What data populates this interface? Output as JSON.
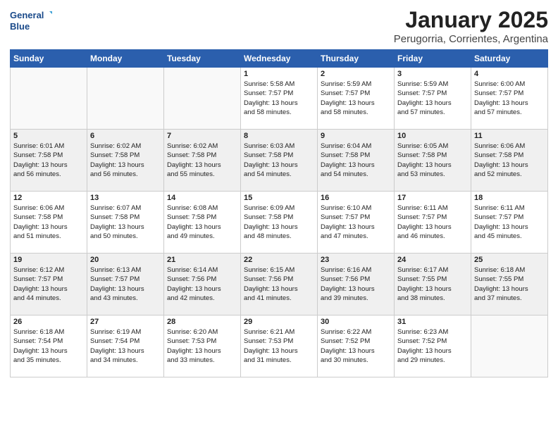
{
  "header": {
    "logo_line1": "General",
    "logo_line2": "Blue",
    "title": "January 2025",
    "subtitle": "Perugorria, Corrientes, Argentina"
  },
  "days_of_week": [
    "Sunday",
    "Monday",
    "Tuesday",
    "Wednesday",
    "Thursday",
    "Friday",
    "Saturday"
  ],
  "weeks": [
    [
      {
        "day": "",
        "text": "",
        "shaded": false,
        "empty": true
      },
      {
        "day": "",
        "text": "",
        "shaded": false,
        "empty": true
      },
      {
        "day": "",
        "text": "",
        "shaded": false,
        "empty": true
      },
      {
        "day": "1",
        "text": "Sunrise: 5:58 AM\nSunset: 7:57 PM\nDaylight: 13 hours\nand 58 minutes.",
        "shaded": false,
        "empty": false
      },
      {
        "day": "2",
        "text": "Sunrise: 5:59 AM\nSunset: 7:57 PM\nDaylight: 13 hours\nand 58 minutes.",
        "shaded": false,
        "empty": false
      },
      {
        "day": "3",
        "text": "Sunrise: 5:59 AM\nSunset: 7:57 PM\nDaylight: 13 hours\nand 57 minutes.",
        "shaded": false,
        "empty": false
      },
      {
        "day": "4",
        "text": "Sunrise: 6:00 AM\nSunset: 7:57 PM\nDaylight: 13 hours\nand 57 minutes.",
        "shaded": false,
        "empty": false
      }
    ],
    [
      {
        "day": "5",
        "text": "Sunrise: 6:01 AM\nSunset: 7:58 PM\nDaylight: 13 hours\nand 56 minutes.",
        "shaded": true,
        "empty": false
      },
      {
        "day": "6",
        "text": "Sunrise: 6:02 AM\nSunset: 7:58 PM\nDaylight: 13 hours\nand 56 minutes.",
        "shaded": true,
        "empty": false
      },
      {
        "day": "7",
        "text": "Sunrise: 6:02 AM\nSunset: 7:58 PM\nDaylight: 13 hours\nand 55 minutes.",
        "shaded": true,
        "empty": false
      },
      {
        "day": "8",
        "text": "Sunrise: 6:03 AM\nSunset: 7:58 PM\nDaylight: 13 hours\nand 54 minutes.",
        "shaded": true,
        "empty": false
      },
      {
        "day": "9",
        "text": "Sunrise: 6:04 AM\nSunset: 7:58 PM\nDaylight: 13 hours\nand 54 minutes.",
        "shaded": true,
        "empty": false
      },
      {
        "day": "10",
        "text": "Sunrise: 6:05 AM\nSunset: 7:58 PM\nDaylight: 13 hours\nand 53 minutes.",
        "shaded": true,
        "empty": false
      },
      {
        "day": "11",
        "text": "Sunrise: 6:06 AM\nSunset: 7:58 PM\nDaylight: 13 hours\nand 52 minutes.",
        "shaded": true,
        "empty": false
      }
    ],
    [
      {
        "day": "12",
        "text": "Sunrise: 6:06 AM\nSunset: 7:58 PM\nDaylight: 13 hours\nand 51 minutes.",
        "shaded": false,
        "empty": false
      },
      {
        "day": "13",
        "text": "Sunrise: 6:07 AM\nSunset: 7:58 PM\nDaylight: 13 hours\nand 50 minutes.",
        "shaded": false,
        "empty": false
      },
      {
        "day": "14",
        "text": "Sunrise: 6:08 AM\nSunset: 7:58 PM\nDaylight: 13 hours\nand 49 minutes.",
        "shaded": false,
        "empty": false
      },
      {
        "day": "15",
        "text": "Sunrise: 6:09 AM\nSunset: 7:58 PM\nDaylight: 13 hours\nand 48 minutes.",
        "shaded": false,
        "empty": false
      },
      {
        "day": "16",
        "text": "Sunrise: 6:10 AM\nSunset: 7:57 PM\nDaylight: 13 hours\nand 47 minutes.",
        "shaded": false,
        "empty": false
      },
      {
        "day": "17",
        "text": "Sunrise: 6:11 AM\nSunset: 7:57 PM\nDaylight: 13 hours\nand 46 minutes.",
        "shaded": false,
        "empty": false
      },
      {
        "day": "18",
        "text": "Sunrise: 6:11 AM\nSunset: 7:57 PM\nDaylight: 13 hours\nand 45 minutes.",
        "shaded": false,
        "empty": false
      }
    ],
    [
      {
        "day": "19",
        "text": "Sunrise: 6:12 AM\nSunset: 7:57 PM\nDaylight: 13 hours\nand 44 minutes.",
        "shaded": true,
        "empty": false
      },
      {
        "day": "20",
        "text": "Sunrise: 6:13 AM\nSunset: 7:57 PM\nDaylight: 13 hours\nand 43 minutes.",
        "shaded": true,
        "empty": false
      },
      {
        "day": "21",
        "text": "Sunrise: 6:14 AM\nSunset: 7:56 PM\nDaylight: 13 hours\nand 42 minutes.",
        "shaded": true,
        "empty": false
      },
      {
        "day": "22",
        "text": "Sunrise: 6:15 AM\nSunset: 7:56 PM\nDaylight: 13 hours\nand 41 minutes.",
        "shaded": true,
        "empty": false
      },
      {
        "day": "23",
        "text": "Sunrise: 6:16 AM\nSunset: 7:56 PM\nDaylight: 13 hours\nand 39 minutes.",
        "shaded": true,
        "empty": false
      },
      {
        "day": "24",
        "text": "Sunrise: 6:17 AM\nSunset: 7:55 PM\nDaylight: 13 hours\nand 38 minutes.",
        "shaded": true,
        "empty": false
      },
      {
        "day": "25",
        "text": "Sunrise: 6:18 AM\nSunset: 7:55 PM\nDaylight: 13 hours\nand 37 minutes.",
        "shaded": true,
        "empty": false
      }
    ],
    [
      {
        "day": "26",
        "text": "Sunrise: 6:18 AM\nSunset: 7:54 PM\nDaylight: 13 hours\nand 35 minutes.",
        "shaded": false,
        "empty": false
      },
      {
        "day": "27",
        "text": "Sunrise: 6:19 AM\nSunset: 7:54 PM\nDaylight: 13 hours\nand 34 minutes.",
        "shaded": false,
        "empty": false
      },
      {
        "day": "28",
        "text": "Sunrise: 6:20 AM\nSunset: 7:53 PM\nDaylight: 13 hours\nand 33 minutes.",
        "shaded": false,
        "empty": false
      },
      {
        "day": "29",
        "text": "Sunrise: 6:21 AM\nSunset: 7:53 PM\nDaylight: 13 hours\nand 31 minutes.",
        "shaded": false,
        "empty": false
      },
      {
        "day": "30",
        "text": "Sunrise: 6:22 AM\nSunset: 7:52 PM\nDaylight: 13 hours\nand 30 minutes.",
        "shaded": false,
        "empty": false
      },
      {
        "day": "31",
        "text": "Sunrise: 6:23 AM\nSunset: 7:52 PM\nDaylight: 13 hours\nand 29 minutes.",
        "shaded": false,
        "empty": false
      },
      {
        "day": "",
        "text": "",
        "shaded": false,
        "empty": true
      }
    ]
  ]
}
